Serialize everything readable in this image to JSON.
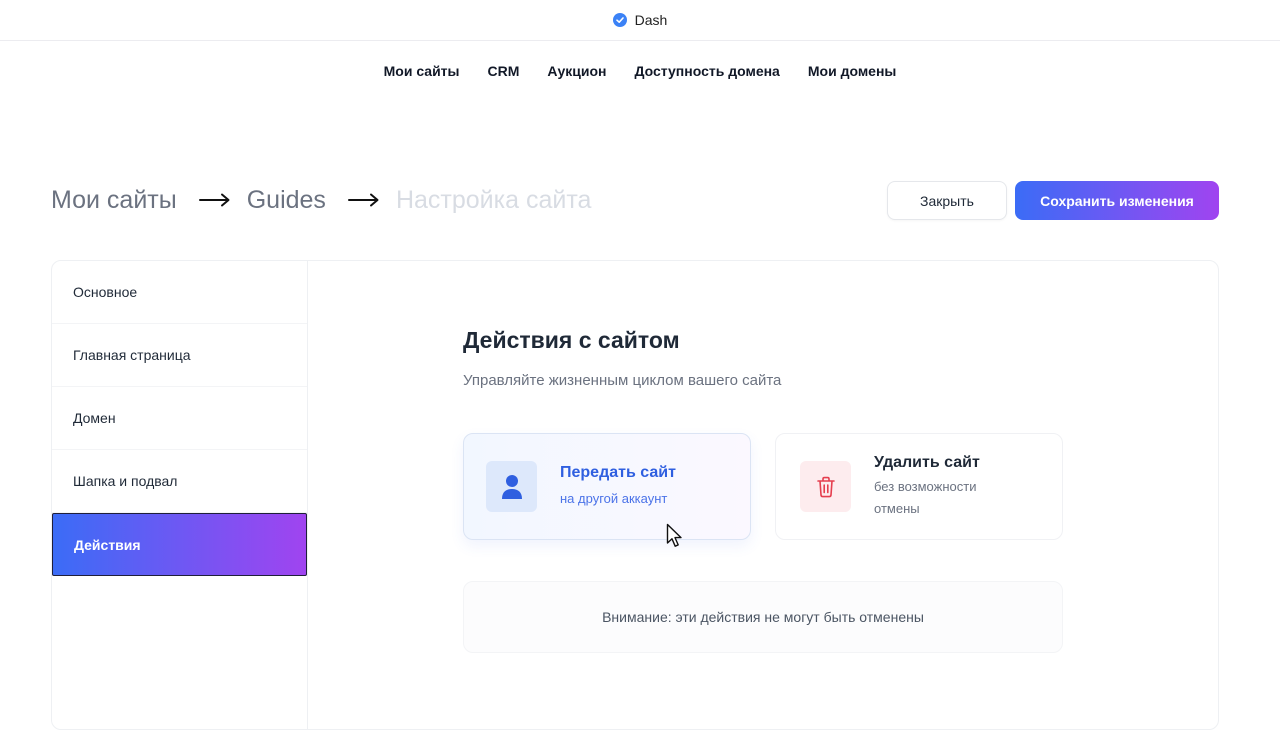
{
  "topbar": {
    "brand": "Dash",
    "brand_icon": "check-circle-icon"
  },
  "nav": {
    "items": [
      {
        "label": "Мои сайты"
      },
      {
        "label": "CRM"
      },
      {
        "label": "Аукцион"
      },
      {
        "label": "Доступность домена"
      },
      {
        "label": "Мои домены"
      }
    ]
  },
  "breadcrumb": {
    "items": [
      {
        "label": "Мои сайты"
      },
      {
        "label": "Guides"
      },
      {
        "label": "Настройка сайта"
      }
    ]
  },
  "actions": {
    "close_label": "Закрыть",
    "save_label": "Сохранить изменения"
  },
  "sidebar": {
    "items": [
      {
        "label": "Основное"
      },
      {
        "label": "Главная страница"
      },
      {
        "label": "Домен"
      },
      {
        "label": "Шапка и подвал"
      },
      {
        "label": "Действия",
        "active": true
      }
    ]
  },
  "content": {
    "title": "Действия с сайтом",
    "subtitle": "Управляйте жизненным циклом вашего сайта",
    "cards": [
      {
        "title": "Передать сайт",
        "desc": "на другой аккаунт",
        "icon": "user-icon"
      },
      {
        "title": "Удалить сайт",
        "desc": "без возможности отмены",
        "icon": "trash-icon"
      }
    ],
    "warning": "Внимание: эти действия не могут быть отменены"
  },
  "colors": {
    "accent_start": "#3b6cf6",
    "accent_end": "#a044f0",
    "danger": "#e53e4e"
  }
}
